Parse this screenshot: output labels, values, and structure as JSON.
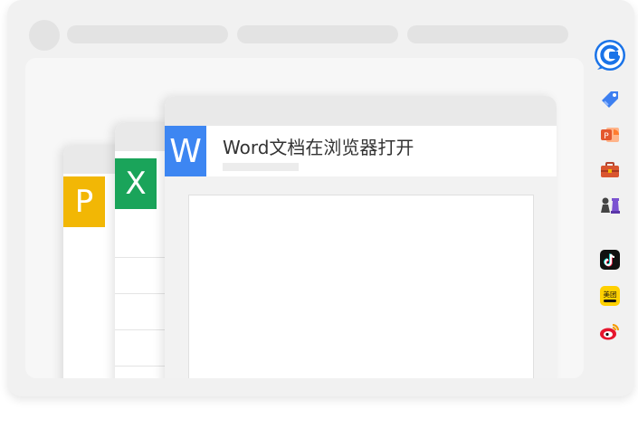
{
  "document": {
    "title": "Word文档在浏览器打开"
  },
  "files": {
    "word_letter": "W",
    "excel_letter": "X",
    "ppt_letter": "P"
  },
  "colors": {
    "word": "#3d86f2",
    "excel": "#1aa45a",
    "ppt": "#f2b705",
    "browser_frame": "#f1f1f1"
  },
  "sidebar": {
    "items": [
      {
        "icon": "browser-logo-icon"
      },
      {
        "icon": "price-tag-icon"
      },
      {
        "icon": "presentation-app-icon"
      },
      {
        "icon": "toolbox-icon"
      },
      {
        "icon": "chess-icon"
      },
      {
        "icon": "tiktok-icon"
      },
      {
        "icon": "meituan-icon",
        "text": "美团"
      },
      {
        "icon": "weibo-icon"
      }
    ]
  }
}
